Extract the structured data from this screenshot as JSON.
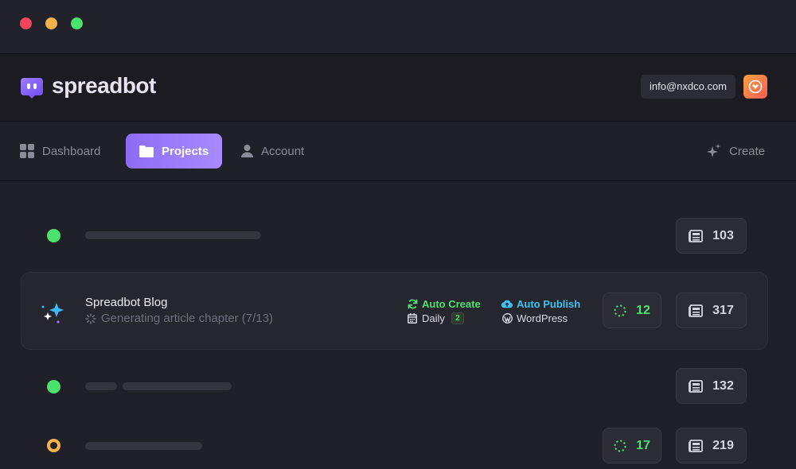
{
  "window": {
    "controls": [
      "close",
      "minimize",
      "maximize"
    ]
  },
  "header": {
    "brand": "spreadbot",
    "email": "info@nxdco.com",
    "avatar_icon": "heart-shield-icon"
  },
  "nav": {
    "dashboard": "Dashboard",
    "projects": "Projects",
    "account": "Account",
    "create": "Create",
    "active": "projects"
  },
  "rows": [
    {
      "status": "green",
      "articles": "103"
    },
    {
      "status": "active",
      "name": "Spreadbot Blog",
      "status_text": "Generating article chapter (7/13)",
      "auto_create": "Auto Create",
      "schedule": "Daily",
      "schedule_count": "2",
      "auto_publish": "Auto Publish",
      "platform": "WordPress",
      "in_progress": "12",
      "articles": "317"
    },
    {
      "status": "green",
      "articles": "132"
    },
    {
      "status": "pending",
      "in_progress": "17",
      "articles": "219"
    }
  ],
  "colors": {
    "accent": "#8d6cf5",
    "success": "#4ce26e",
    "info": "#3fc4ef",
    "warning": "#f4b24a"
  }
}
